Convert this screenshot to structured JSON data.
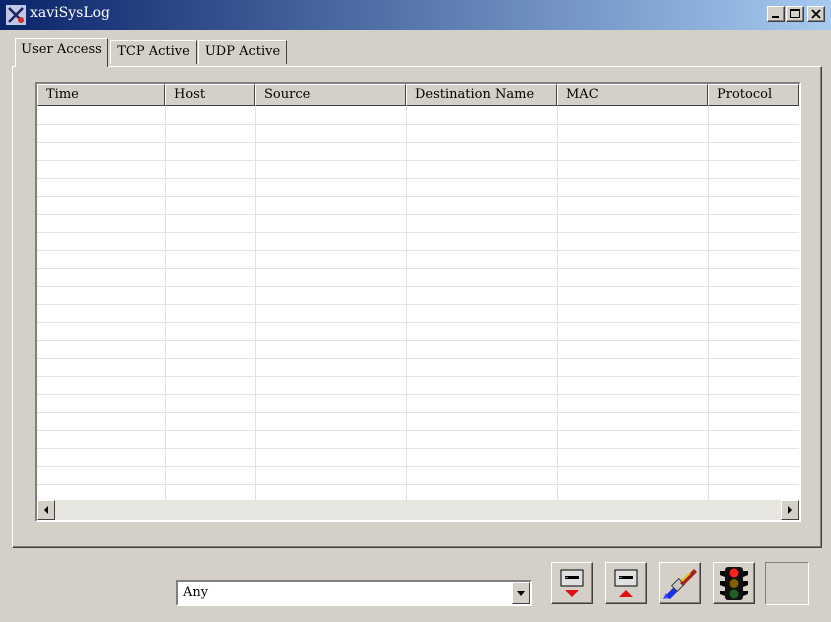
{
  "window": {
    "title": "xaviSysLog"
  },
  "tabs": [
    {
      "label": "User Access",
      "active": true
    },
    {
      "label": "TCP Active",
      "active": false
    },
    {
      "label": "UDP Active",
      "active": false
    }
  ],
  "listview": {
    "columns": [
      "Time",
      "Host",
      "Source",
      "Destination Name",
      "MAC",
      "Protocol"
    ],
    "rows": []
  },
  "filter": {
    "selected": "Any"
  },
  "toolbar": {
    "icons": [
      "move-down-icon",
      "move-up-icon",
      "brush-clear-icon",
      "traffic-light-icon"
    ]
  },
  "colors": {
    "titlebar_start": "#0a246a",
    "titlebar_end": "#a6caf0",
    "face": "#d4d0c8"
  }
}
